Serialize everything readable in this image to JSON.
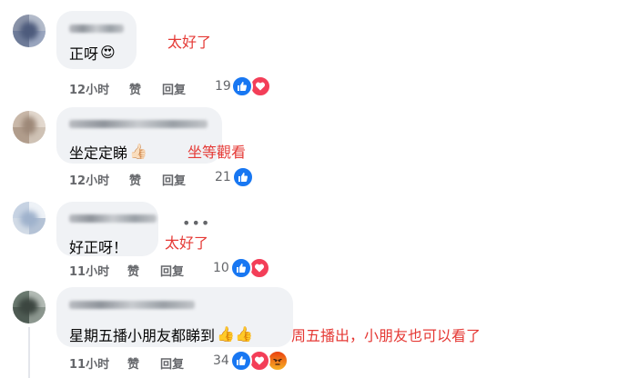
{
  "comments": [
    {
      "text": "正呀",
      "emoji": "😍",
      "note": "太好了",
      "time": "12小时",
      "like": "赞",
      "reply": "回复",
      "count": "19",
      "reactions": [
        "like-icon",
        "love-icon"
      ]
    },
    {
      "text": "坐定定睇",
      "emoji": "👍🏻",
      "note": "坐等觀看",
      "time": "12小时",
      "like": "赞",
      "reply": "回复",
      "count": "21",
      "reactions": [
        "like-icon"
      ]
    },
    {
      "text": "好正呀！",
      "emoji": "",
      "note": "太好了",
      "time": "11小时",
      "like": "赞",
      "reply": "回复",
      "count": "10",
      "reactions": [
        "like-icon",
        "love-icon"
      ],
      "more": "•••"
    },
    {
      "text": "星期五播小朋友都睇到",
      "emoji": "👍👍",
      "note": "周五播出，小朋友也可以看了",
      "time": "11小时",
      "like": "赞",
      "reply": "回复",
      "count": "34",
      "reactions": [
        "like-icon",
        "love-icon",
        "angry-icon"
      ]
    }
  ],
  "colors": {
    "like": "#1877f2",
    "love": "#f33e58",
    "angry": "#e9710f",
    "note": "#e53935",
    "bubble": "#f0f2f5",
    "meta": "#65676b"
  }
}
